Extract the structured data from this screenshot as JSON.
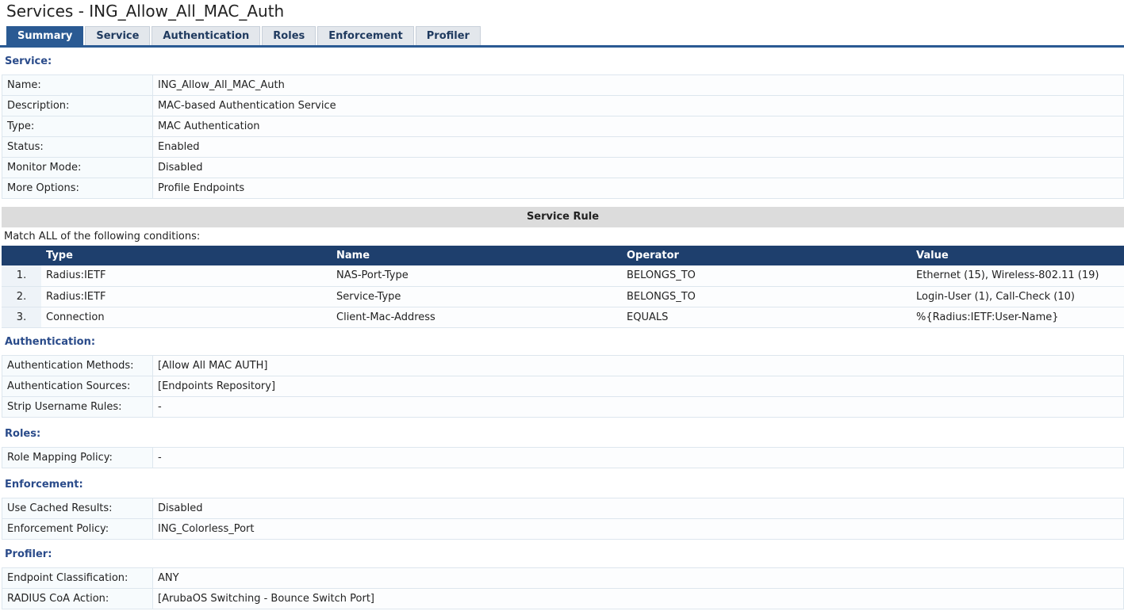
{
  "page": {
    "title": "Services - ING_Allow_All_MAC_Auth"
  },
  "tabs": [
    {
      "label": "Summary"
    },
    {
      "label": "Service"
    },
    {
      "label": "Authentication"
    },
    {
      "label": "Roles"
    },
    {
      "label": "Enforcement"
    },
    {
      "label": "Profiler"
    }
  ],
  "service": {
    "heading": "Service:",
    "rows": [
      {
        "label": "Name:",
        "value": "ING_Allow_All_MAC_Auth"
      },
      {
        "label": "Description:",
        "value": "MAC-based Authentication Service"
      },
      {
        "label": "Type:",
        "value": "MAC Authentication"
      },
      {
        "label": "Status:",
        "value": "Enabled"
      },
      {
        "label": "Monitor Mode:",
        "value": "Disabled"
      },
      {
        "label": "More Options:",
        "value": "Profile Endpoints"
      }
    ]
  },
  "service_rule": {
    "heading": "Service Rule",
    "match_text": "Match ALL of the following conditions:",
    "columns": {
      "type": "Type",
      "name": "Name",
      "operator": "Operator",
      "value": "Value"
    },
    "rows": [
      {
        "num": "1.",
        "type": "Radius:IETF",
        "name": "NAS-Port-Type",
        "operator": "BELONGS_TO",
        "value": "Ethernet (15), Wireless-802.11 (19)"
      },
      {
        "num": "2.",
        "type": "Radius:IETF",
        "name": "Service-Type",
        "operator": "BELONGS_TO",
        "value": "Login-User (1), Call-Check (10)"
      },
      {
        "num": "3.",
        "type": "Connection",
        "name": "Client-Mac-Address",
        "operator": "EQUALS",
        "value": "%{Radius:IETF:User-Name}"
      }
    ]
  },
  "authentication": {
    "heading": "Authentication:",
    "rows": [
      {
        "label": "Authentication Methods:",
        "value": "[Allow All MAC AUTH]"
      },
      {
        "label": "Authentication Sources:",
        "value": "[Endpoints Repository]"
      },
      {
        "label": "Strip Username Rules:",
        "value": "-"
      }
    ]
  },
  "roles": {
    "heading": "Roles:",
    "rows": [
      {
        "label": "Role Mapping Policy:",
        "value": "-"
      }
    ]
  },
  "enforcement": {
    "heading": "Enforcement:",
    "rows": [
      {
        "label": "Use Cached Results:",
        "value": "Disabled"
      },
      {
        "label": "Enforcement Policy:",
        "value": "ING_Colorless_Port"
      }
    ]
  },
  "profiler": {
    "heading": "Profiler:",
    "rows": [
      {
        "label": "Endpoint Classification:",
        "value": "ANY"
      },
      {
        "label": "RADIUS CoA Action:",
        "value": "[ArubaOS Switching - Bounce Switch Port]"
      }
    ]
  }
}
